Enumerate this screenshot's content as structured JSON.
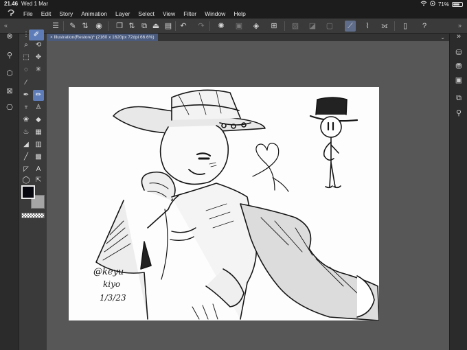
{
  "status": {
    "time": "21.46",
    "date": "Wed 1 Mar",
    "battery": "71%",
    "battery_level": 0.71,
    "icons": [
      "wifi-icon",
      "orientation-lock-icon",
      "battery-icon"
    ]
  },
  "menu": {
    "items": [
      "File",
      "Edit",
      "Story",
      "Animation",
      "Layer",
      "Select",
      "View",
      "Filter",
      "Window",
      "Help"
    ]
  },
  "document": {
    "tab_title": "Illustration(Restore)* (2160 x 1620px 72dpi 66.6%)"
  },
  "artwork": {
    "signature_handle": "@keyu",
    "signature_name": "kiyo",
    "signature_date": "1/3/23"
  },
  "colors": {
    "main_color": "#07070f",
    "sub_color": "#a5a5a5",
    "accent": "#5e7db8",
    "tab_accent": "#4a5b7e"
  }
}
